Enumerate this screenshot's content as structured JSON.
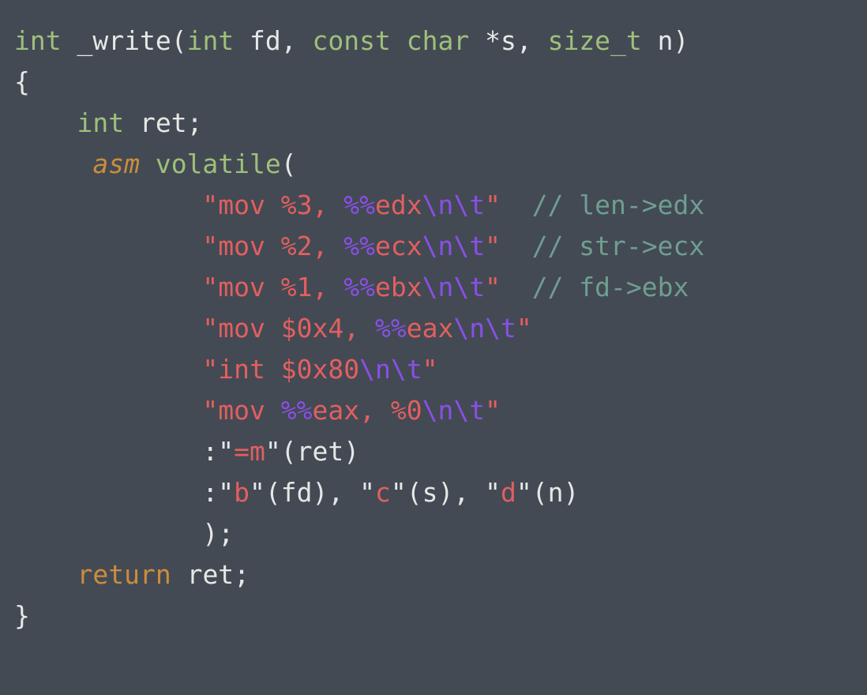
{
  "editor": {
    "background_color": "#434a54",
    "language": "c",
    "font_size_px": 33,
    "line_height_px": 52,
    "tab_width": 4
  },
  "palette": {
    "plain": "#e6e8e6",
    "keyword": "#9ec07a",
    "type": "#9ec07a",
    "storage": "#cc8c3c",
    "return_keyword": "#cc8c3c",
    "string": "#e35f5f",
    "escape": "#8a4fe8",
    "percent_register": "#8a4fe8",
    "comment": "#6f9e90",
    "punctuation": "#e6e8e6"
  },
  "code": {
    "plain_text": "int _write(int fd, const char *s, size_t n)\n{\n    int ret;\n     asm volatile(\n            \"mov %3, %%edx\\n\\t\"  // len->edx\n            \"mov %2, %%ecx\\n\\t\"  // str->ecx\n            \"mov %1, %%ebx\\n\\t\"  // fd->ebx\n            \"mov $0x4, %%eax\\n\\t\"\n            \"int $0x80\\n\\t\"\n            \"mov %%eax, %0\\n\\t\"\n            :\"=m\"(ret)\n            :\"b\"(fd), \"c\"(s), \"d\"(n)\n            );\n    return ret;\n}",
    "lines": [
      {
        "indent": 0,
        "tokens": [
          {
            "text": "int",
            "kind": "type"
          },
          {
            "text": " ",
            "kind": "plain"
          },
          {
            "text": "_write",
            "kind": "plain"
          },
          {
            "text": "(",
            "kind": "punct"
          },
          {
            "text": "int",
            "kind": "type"
          },
          {
            "text": " fd, ",
            "kind": "plain"
          },
          {
            "text": "const",
            "kind": "keyword"
          },
          {
            "text": " ",
            "kind": "plain"
          },
          {
            "text": "char",
            "kind": "type"
          },
          {
            "text": " *s, ",
            "kind": "plain"
          },
          {
            "text": "size_t",
            "kind": "type"
          },
          {
            "text": " n)",
            "kind": "plain"
          }
        ]
      },
      {
        "indent": 0,
        "tokens": [
          {
            "text": "{",
            "kind": "punct"
          }
        ]
      },
      {
        "indent": 4,
        "tokens": [
          {
            "text": "int",
            "kind": "type"
          },
          {
            "text": " ret;",
            "kind": "plain"
          }
        ]
      },
      {
        "indent": 5,
        "tokens": [
          {
            "text": "asm",
            "kind": "storage"
          },
          {
            "text": " ",
            "kind": "plain"
          },
          {
            "text": "volatile",
            "kind": "keyword"
          },
          {
            "text": "(",
            "kind": "punct"
          }
        ]
      },
      {
        "indent": 12,
        "tokens": [
          {
            "text": "\"mov %3, ",
            "kind": "string"
          },
          {
            "text": "%%",
            "kind": "percent"
          },
          {
            "text": "edx",
            "kind": "string"
          },
          {
            "text": "\\n\\t",
            "kind": "escape"
          },
          {
            "text": "\"",
            "kind": "string"
          },
          {
            "text": "  ",
            "kind": "plain"
          },
          {
            "text": "// len->edx",
            "kind": "comment"
          }
        ]
      },
      {
        "indent": 12,
        "tokens": [
          {
            "text": "\"mov %2, ",
            "kind": "string"
          },
          {
            "text": "%%",
            "kind": "percent"
          },
          {
            "text": "ecx",
            "kind": "string"
          },
          {
            "text": "\\n\\t",
            "kind": "escape"
          },
          {
            "text": "\"",
            "kind": "string"
          },
          {
            "text": "  ",
            "kind": "plain"
          },
          {
            "text": "// str->ecx",
            "kind": "comment"
          }
        ]
      },
      {
        "indent": 12,
        "tokens": [
          {
            "text": "\"mov %1, ",
            "kind": "string"
          },
          {
            "text": "%%",
            "kind": "percent"
          },
          {
            "text": "ebx",
            "kind": "string"
          },
          {
            "text": "\\n\\t",
            "kind": "escape"
          },
          {
            "text": "\"",
            "kind": "string"
          },
          {
            "text": "  ",
            "kind": "plain"
          },
          {
            "text": "// fd->ebx",
            "kind": "comment"
          }
        ]
      },
      {
        "indent": 12,
        "tokens": [
          {
            "text": "\"mov $0x4, ",
            "kind": "string"
          },
          {
            "text": "%%",
            "kind": "percent"
          },
          {
            "text": "eax",
            "kind": "string"
          },
          {
            "text": "\\n\\t",
            "kind": "escape"
          },
          {
            "text": "\"",
            "kind": "string"
          }
        ]
      },
      {
        "indent": 12,
        "tokens": [
          {
            "text": "\"int $0x80",
            "kind": "string"
          },
          {
            "text": "\\n\\t",
            "kind": "escape"
          },
          {
            "text": "\"",
            "kind": "string"
          }
        ]
      },
      {
        "indent": 12,
        "tokens": [
          {
            "text": "\"mov ",
            "kind": "string"
          },
          {
            "text": "%%",
            "kind": "percent"
          },
          {
            "text": "eax, %0",
            "kind": "string"
          },
          {
            "text": "\\n\\t",
            "kind": "escape"
          },
          {
            "text": "\"",
            "kind": "string"
          }
        ]
      },
      {
        "indent": 12,
        "tokens": [
          {
            "text": ":",
            "kind": "punct"
          },
          {
            "text": "\"",
            "kind": "plain"
          },
          {
            "text": "=m",
            "kind": "string"
          },
          {
            "text": "\"",
            "kind": "plain"
          },
          {
            "text": "(ret)",
            "kind": "plain"
          }
        ]
      },
      {
        "indent": 12,
        "tokens": [
          {
            "text": ":",
            "kind": "punct"
          },
          {
            "text": "\"",
            "kind": "plain"
          },
          {
            "text": "b",
            "kind": "string"
          },
          {
            "text": "\"",
            "kind": "plain"
          },
          {
            "text": "(fd), ",
            "kind": "plain"
          },
          {
            "text": "\"",
            "kind": "plain"
          },
          {
            "text": "c",
            "kind": "string"
          },
          {
            "text": "\"",
            "kind": "plain"
          },
          {
            "text": "(s), ",
            "kind": "plain"
          },
          {
            "text": "\"",
            "kind": "plain"
          },
          {
            "text": "d",
            "kind": "string"
          },
          {
            "text": "\"",
            "kind": "plain"
          },
          {
            "text": "(n)",
            "kind": "plain"
          }
        ]
      },
      {
        "indent": 12,
        "tokens": [
          {
            "text": ");",
            "kind": "punct"
          }
        ]
      },
      {
        "indent": 4,
        "tokens": [
          {
            "text": "return",
            "kind": "return"
          },
          {
            "text": " ret;",
            "kind": "plain"
          }
        ]
      },
      {
        "indent": 0,
        "tokens": [
          {
            "text": "}",
            "kind": "punct"
          }
        ]
      }
    ]
  }
}
